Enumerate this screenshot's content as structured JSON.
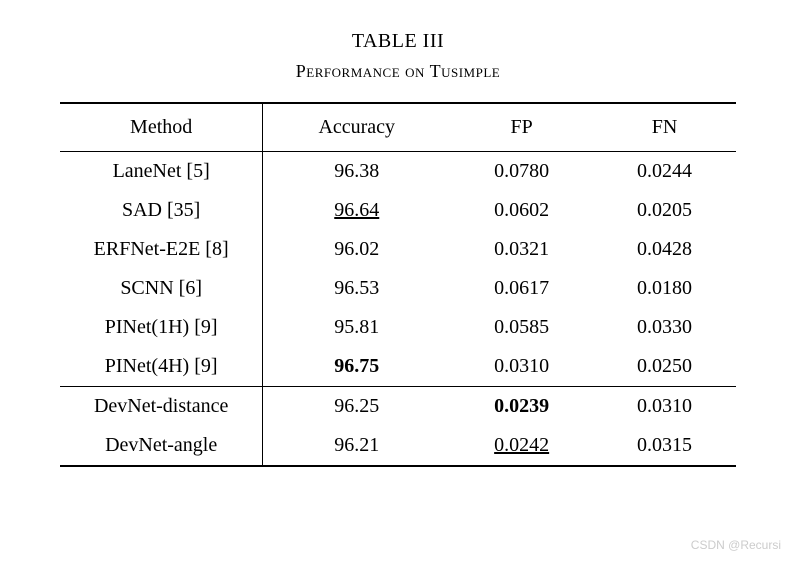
{
  "table_number": "TABLE III",
  "caption": "Performance on Tusimple",
  "headers": {
    "method": "Method",
    "accuracy": "Accuracy",
    "fp": "FP",
    "fn": "FN"
  },
  "group1": [
    {
      "method": "LaneNet [5]",
      "accuracy": "96.38",
      "fp": "0.0780",
      "fn": "0.0244"
    },
    {
      "method": "SAD [35]",
      "accuracy": "96.64",
      "accuracy_style": "underline",
      "fp": "0.0602",
      "fn": "0.0205"
    },
    {
      "method": "ERFNet-E2E [8]",
      "accuracy": "96.02",
      "fp": "0.0321",
      "fn": "0.0428"
    },
    {
      "method": "SCNN [6]",
      "accuracy": "96.53",
      "fp": "0.0617",
      "fn": "0.0180"
    },
    {
      "method": "PINet(1H) [9]",
      "accuracy": "95.81",
      "fp": "0.0585",
      "fn": "0.0330"
    },
    {
      "method": "PINet(4H) [9]",
      "accuracy": "96.75",
      "accuracy_style": "bold",
      "fp": "0.0310",
      "fn": "0.0250"
    }
  ],
  "group2": [
    {
      "method": "DevNet-distance",
      "accuracy": "96.25",
      "fp": "0.0239",
      "fp_style": "bold",
      "fn": "0.0310"
    },
    {
      "method": "DevNet-angle",
      "accuracy": "96.21",
      "fp": "0.0242",
      "fp_style": "underline",
      "fn": "0.0315"
    }
  ],
  "watermark": "CSDN @Recursi",
  "chart_data": {
    "type": "table",
    "title": "TABLE III — Performance on Tusimple",
    "columns": [
      "Method",
      "Accuracy",
      "FP",
      "FN"
    ],
    "rows": [
      [
        "LaneNet [5]",
        96.38,
        0.078,
        0.0244
      ],
      [
        "SAD [35]",
        96.64,
        0.0602,
        0.0205
      ],
      [
        "ERFNet-E2E [8]",
        96.02,
        0.0321,
        0.0428
      ],
      [
        "SCNN [6]",
        96.53,
        0.0617,
        0.018
      ],
      [
        "PINet(1H) [9]",
        95.81,
        0.0585,
        0.033
      ],
      [
        "PINet(4H) [9]",
        96.75,
        0.031,
        0.025
      ],
      [
        "DevNet-distance",
        96.25,
        0.0239,
        0.031
      ],
      [
        "DevNet-angle",
        96.21,
        0.0242,
        0.0315
      ]
    ]
  }
}
